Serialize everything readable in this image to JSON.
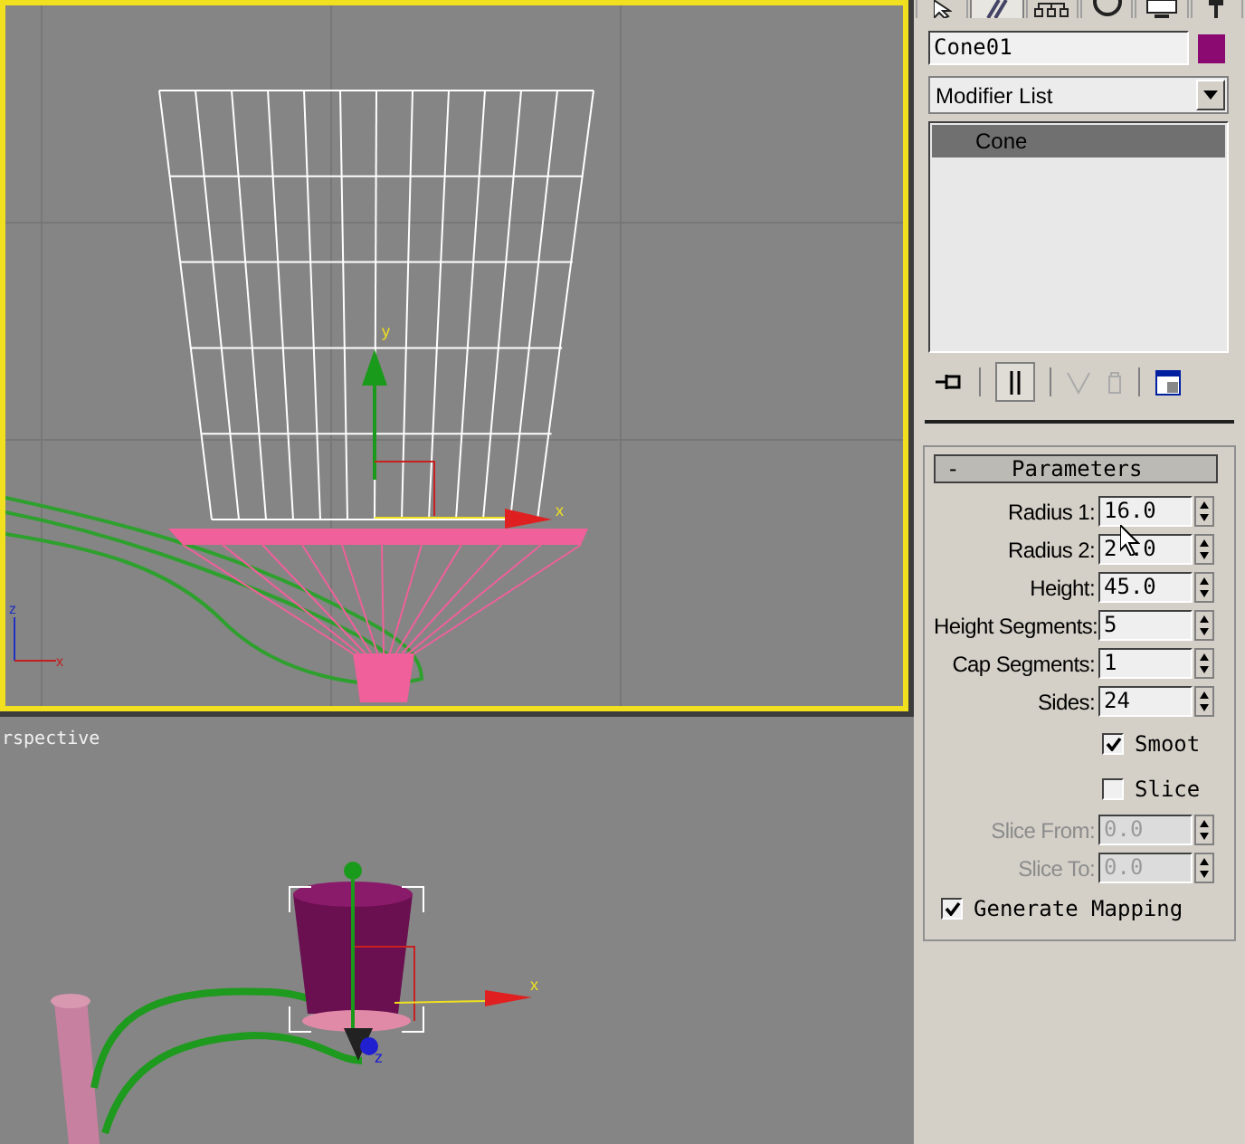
{
  "top_viewport": {
    "active": true,
    "gizmo_axes": [
      "y",
      "x"
    ],
    "tripod_axes": [
      "z",
      "x"
    ]
  },
  "bottom_viewport": {
    "label": "rspective",
    "gizmo_axes": [
      "x",
      "z"
    ]
  },
  "command_tabs": [
    {
      "selected": false
    },
    {
      "selected": true
    },
    {
      "selected": false
    },
    {
      "selected": false
    },
    {
      "selected": false
    },
    {
      "selected": false
    }
  ],
  "object_name": "Cone01",
  "modifier_list": "Modifier List",
  "modifier_stack": [
    {
      "label": "Cone",
      "selected": true
    }
  ],
  "rollout": {
    "toggle": "-",
    "title": "Parameters"
  },
  "rows": [
    {
      "kind": "spinner",
      "label": "Radius 1:",
      "value": "16.0",
      "disabled": false
    },
    {
      "kind": "spinner",
      "label": "Radius 2:",
      "value": "2 .0",
      "disabled": false
    },
    {
      "kind": "spinner",
      "label": "Height:",
      "value": "45.0",
      "disabled": false
    },
    {
      "kind": "spinner",
      "label": "Height Segments:",
      "value": "5",
      "disabled": false
    },
    {
      "kind": "spinner",
      "label": "Cap Segments:",
      "value": "1",
      "disabled": false
    },
    {
      "kind": "spinner",
      "label": "Sides:",
      "value": "24",
      "disabled": false
    },
    {
      "kind": "checkbox",
      "label": "Smoot",
      "checked": true
    },
    {
      "kind": "checkbox",
      "label": "Slice",
      "checked": false
    },
    {
      "kind": "spinner",
      "label": "Slice From:",
      "value": "0.0",
      "disabled": true
    },
    {
      "kind": "spinner",
      "label": "Slice To:",
      "value": "0.0",
      "disabled": true
    },
    {
      "kind": "wide_checkbox",
      "label": "Generate Mapping",
      "checked": true
    }
  ]
}
